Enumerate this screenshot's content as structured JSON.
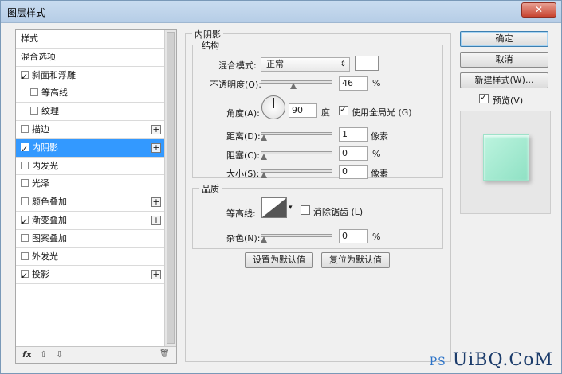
{
  "window": {
    "title": "图层样式",
    "close_glyph": "✕"
  },
  "style_list": {
    "items": [
      {
        "label": "样式",
        "checkbox": false,
        "checked": false,
        "indent": false,
        "plus": false,
        "selected": false
      },
      {
        "label": "混合选项",
        "checkbox": false,
        "checked": false,
        "indent": false,
        "plus": false,
        "selected": false
      },
      {
        "label": "斜面和浮雕",
        "checkbox": true,
        "checked": true,
        "indent": false,
        "plus": false,
        "selected": false
      },
      {
        "label": "等高线",
        "checkbox": true,
        "checked": false,
        "indent": true,
        "plus": false,
        "selected": false
      },
      {
        "label": "纹理",
        "checkbox": true,
        "checked": false,
        "indent": true,
        "plus": false,
        "selected": false
      },
      {
        "label": "描边",
        "checkbox": true,
        "checked": false,
        "indent": false,
        "plus": true,
        "selected": false
      },
      {
        "label": "内阴影",
        "checkbox": true,
        "checked": true,
        "indent": false,
        "plus": true,
        "selected": true
      },
      {
        "label": "内发光",
        "checkbox": true,
        "checked": false,
        "indent": false,
        "plus": false,
        "selected": false
      },
      {
        "label": "光泽",
        "checkbox": true,
        "checked": false,
        "indent": false,
        "plus": false,
        "selected": false
      },
      {
        "label": "颜色叠加",
        "checkbox": true,
        "checked": false,
        "indent": false,
        "plus": true,
        "selected": false
      },
      {
        "label": "渐变叠加",
        "checkbox": true,
        "checked": true,
        "indent": false,
        "plus": true,
        "selected": false
      },
      {
        "label": "图案叠加",
        "checkbox": true,
        "checked": false,
        "indent": false,
        "plus": false,
        "selected": false
      },
      {
        "label": "外发光",
        "checkbox": true,
        "checked": false,
        "indent": false,
        "plus": false,
        "selected": false
      },
      {
        "label": "投影",
        "checkbox": true,
        "checked": true,
        "indent": false,
        "plus": true,
        "selected": false
      }
    ],
    "footer": {
      "fx": "fx",
      "up": "⇧",
      "down": "⇩",
      "trash": "🗑"
    }
  },
  "inner_shadow": {
    "title": "内阴影",
    "structure": {
      "title": "结构",
      "blend_mode_label": "混合模式:",
      "blend_mode_value": "正常",
      "opacity_label": "不透明度(O):",
      "opacity_value": "46",
      "opacity_fraction": 0.46,
      "opacity_unit": "%",
      "angle_label": "角度(A):",
      "angle_value": "90",
      "angle_unit": "度",
      "global_light_label": "使用全局光 (G)",
      "global_light_checked": true,
      "distance_label": "距离(D):",
      "distance_value": "1",
      "distance_unit": "像素",
      "choke_label": "阻塞(C):",
      "choke_value": "0",
      "choke_unit": "%",
      "size_label": "大小(S):",
      "size_value": "0",
      "size_unit": "像素"
    },
    "quality": {
      "title": "品质",
      "contour_label": "等高线:",
      "anti_alias_label": "消除锯齿 (L)",
      "anti_alias_checked": false,
      "noise_label": "杂色(N):",
      "noise_value": "0",
      "noise_unit": "%"
    },
    "make_default": "设置为默认值",
    "reset_default": "复位为默认值"
  },
  "buttons": {
    "ok": "确定",
    "cancel": "取消",
    "new_style": "新建样式(W)...",
    "preview_label": "预览(V)",
    "preview_checked": true
  },
  "colors": {
    "selection": "#3399ff",
    "preview_tile": "#a6ebd2"
  },
  "watermark": {
    "ps": "PS",
    "site": "UiBQ.CoM"
  }
}
